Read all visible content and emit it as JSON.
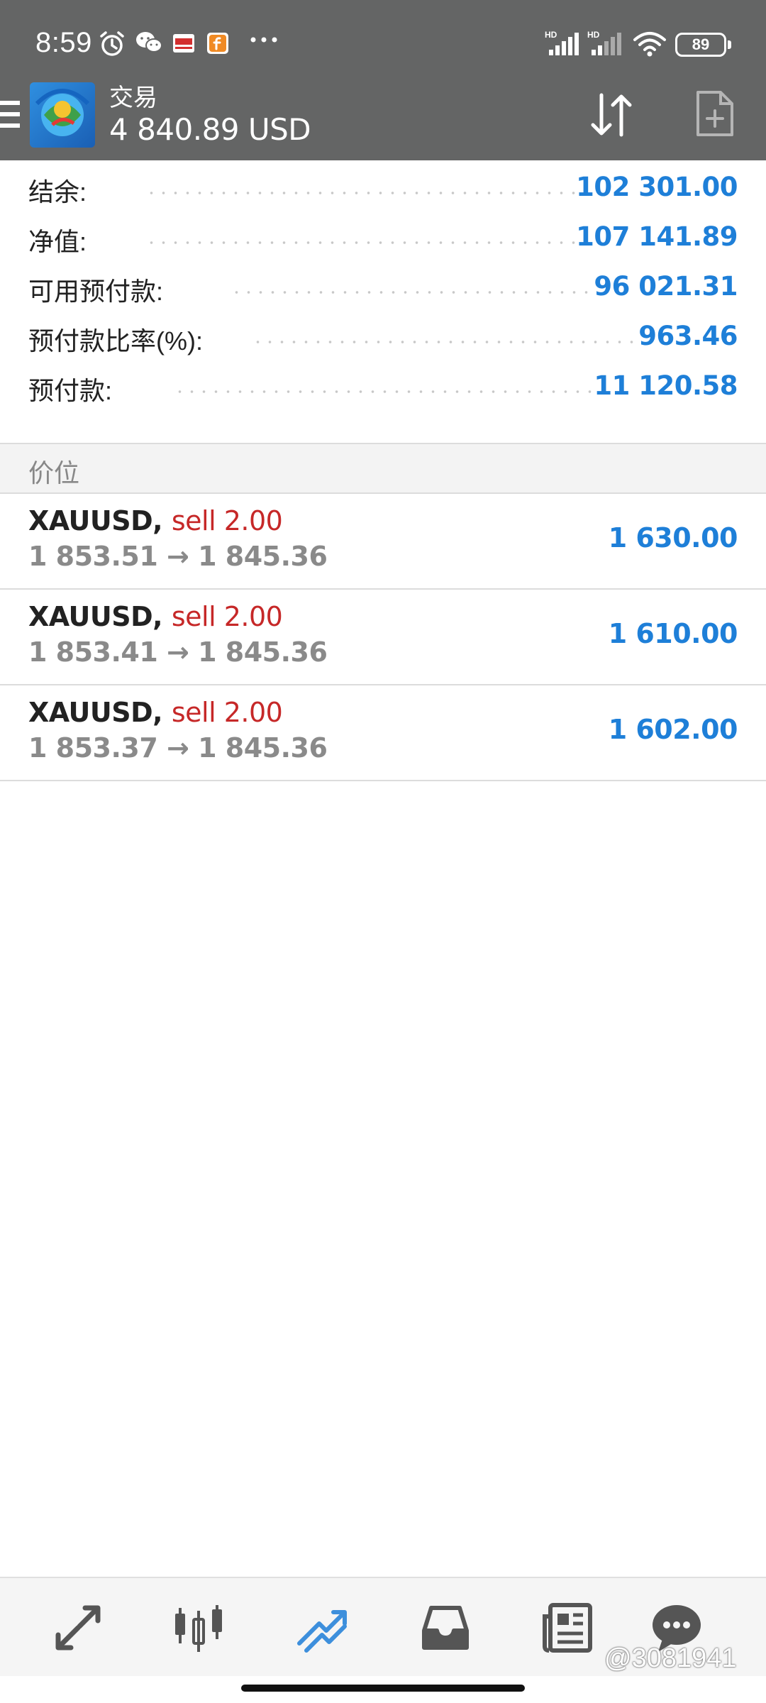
{
  "status_bar": {
    "time": "8:59",
    "battery": "89",
    "icons": [
      "alarm-icon",
      "wechat-icon",
      "news-app-icon",
      "f-app-icon",
      "more-icon",
      "hd-signal-icon",
      "hd-signal-icon",
      "wifi-icon",
      "battery-icon"
    ],
    "signal_label": "HD"
  },
  "header": {
    "title": "交易",
    "balance": "4 840.89 USD",
    "background": "#646565"
  },
  "summary": {
    "rows": [
      {
        "label": "结余:",
        "value": "102 301.00"
      },
      {
        "label": "净值:",
        "value": "107 141.89"
      },
      {
        "label": "可用预付款:",
        "value": "96 021.31"
      },
      {
        "label": "预付款比率(%):",
        "value": "963.46"
      },
      {
        "label": "预付款:",
        "value": "11 120.58"
      }
    ],
    "value_color": "#1e7fd8"
  },
  "section": {
    "title": "价位"
  },
  "positions": [
    {
      "symbol": "XAUUSD,",
      "side": "sell 2.00",
      "prices": "1 853.51 → 1 845.36",
      "profit": "1 630.00"
    },
    {
      "symbol": "XAUUSD,",
      "side": "sell 2.00",
      "prices": "1 853.41 → 1 845.36",
      "profit": "1 610.00"
    },
    {
      "symbol": "XAUUSD,",
      "side": "sell 2.00",
      "prices": "1 853.37 → 1 845.36",
      "profit": "1 602.00"
    }
  ],
  "colors": {
    "sell": "#c62828",
    "profit": "#1e7fd8",
    "active_nav": "#3d8fdc"
  },
  "bottom_nav": {
    "items": [
      "quotes-icon",
      "chart-icon",
      "trade-icon",
      "history-icon",
      "news-icon",
      "chat-icon"
    ],
    "active": "trade-icon"
  },
  "watermark": "@3081941"
}
